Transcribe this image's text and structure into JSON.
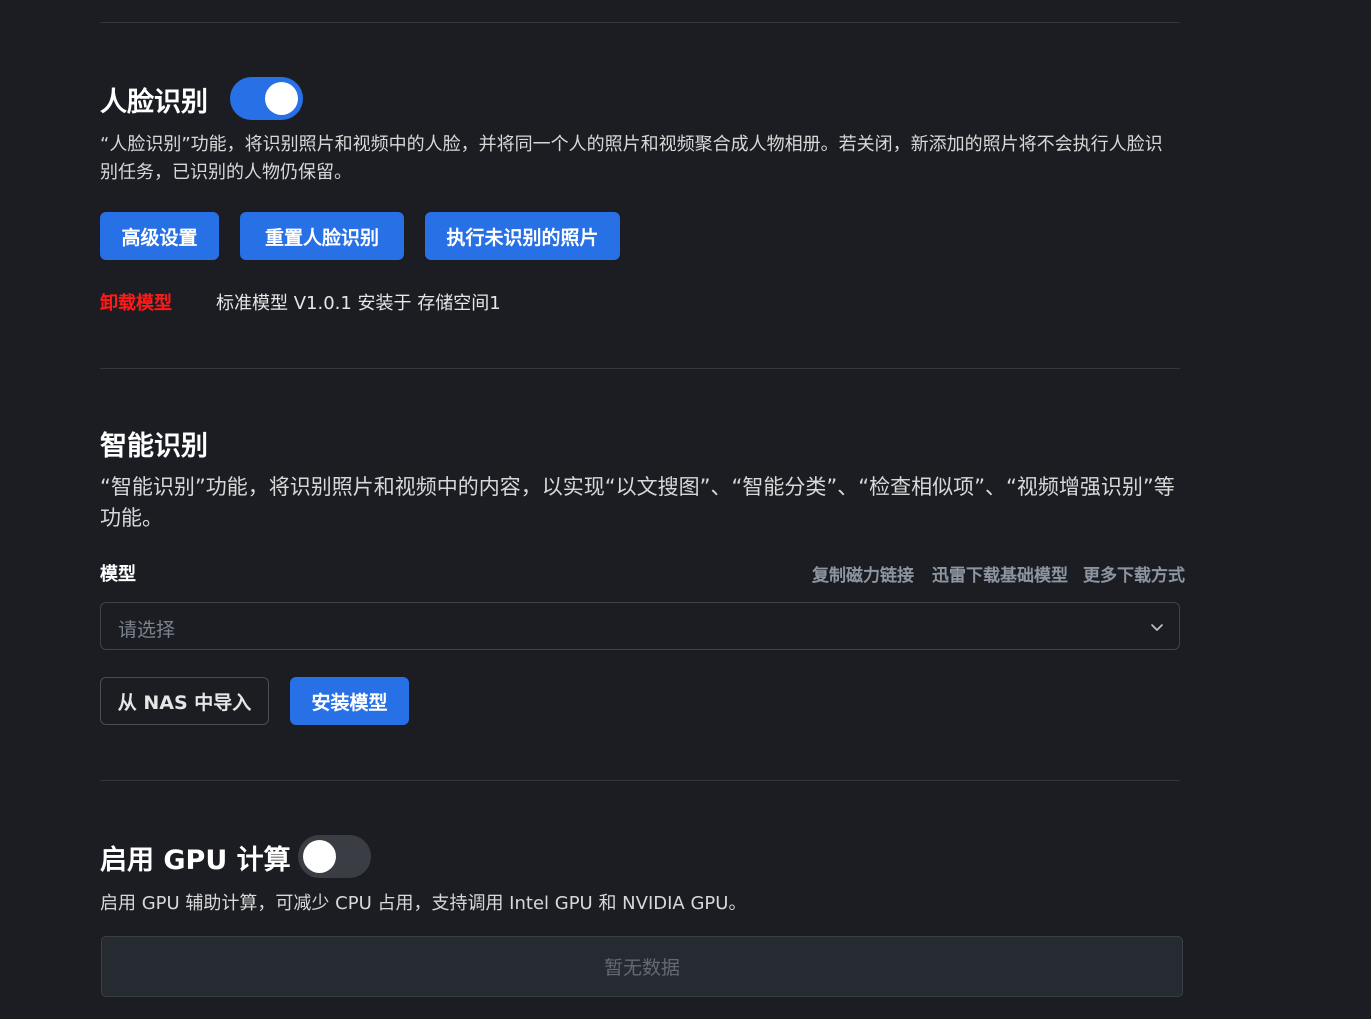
{
  "face": {
    "title": "人脸识别",
    "enabled": true,
    "description": "“人脸识别”功能，将识别照片和视频中的人脸，并将同一个人的照片和视频聚合成人物相册。若关闭，新添加的照片将不会执行人脸识别任务，已识别的人物仍保留。",
    "buttons": {
      "advanced": "高级设置",
      "reset": "重置人脸识别",
      "run_unrecognized": "执行未识别的照片"
    },
    "uninstall_label": "卸载模型",
    "model_info": "标准模型 V1.0.1 安装于 存储空间1"
  },
  "smart": {
    "title": "智能识别",
    "description": "“智能识别”功能，将识别照片和视频中的内容，以实现“以文搜图”、“智能分类”、“检查相似项”、“视频增强识别”等功能。",
    "model_label": "模型",
    "links": {
      "copy_magnet": "复制磁力链接",
      "thunder_download": "迅雷下载基础模型",
      "more_download": "更多下载方式"
    },
    "select_placeholder": "请选择",
    "buttons": {
      "import_nas": "从 NAS 中导入",
      "install": "安装模型"
    }
  },
  "gpu": {
    "title": "启用 GPU 计算",
    "enabled": false,
    "description": "启用 GPU 辅助计算，可减少 CPU 占用，支持调用 Intel GPU 和 NVIDIA GPU。",
    "empty_text": "暂无数据"
  },
  "colors": {
    "accent": "#2870e6",
    "danger": "#ff1a1a",
    "background": "#1b1d22"
  }
}
